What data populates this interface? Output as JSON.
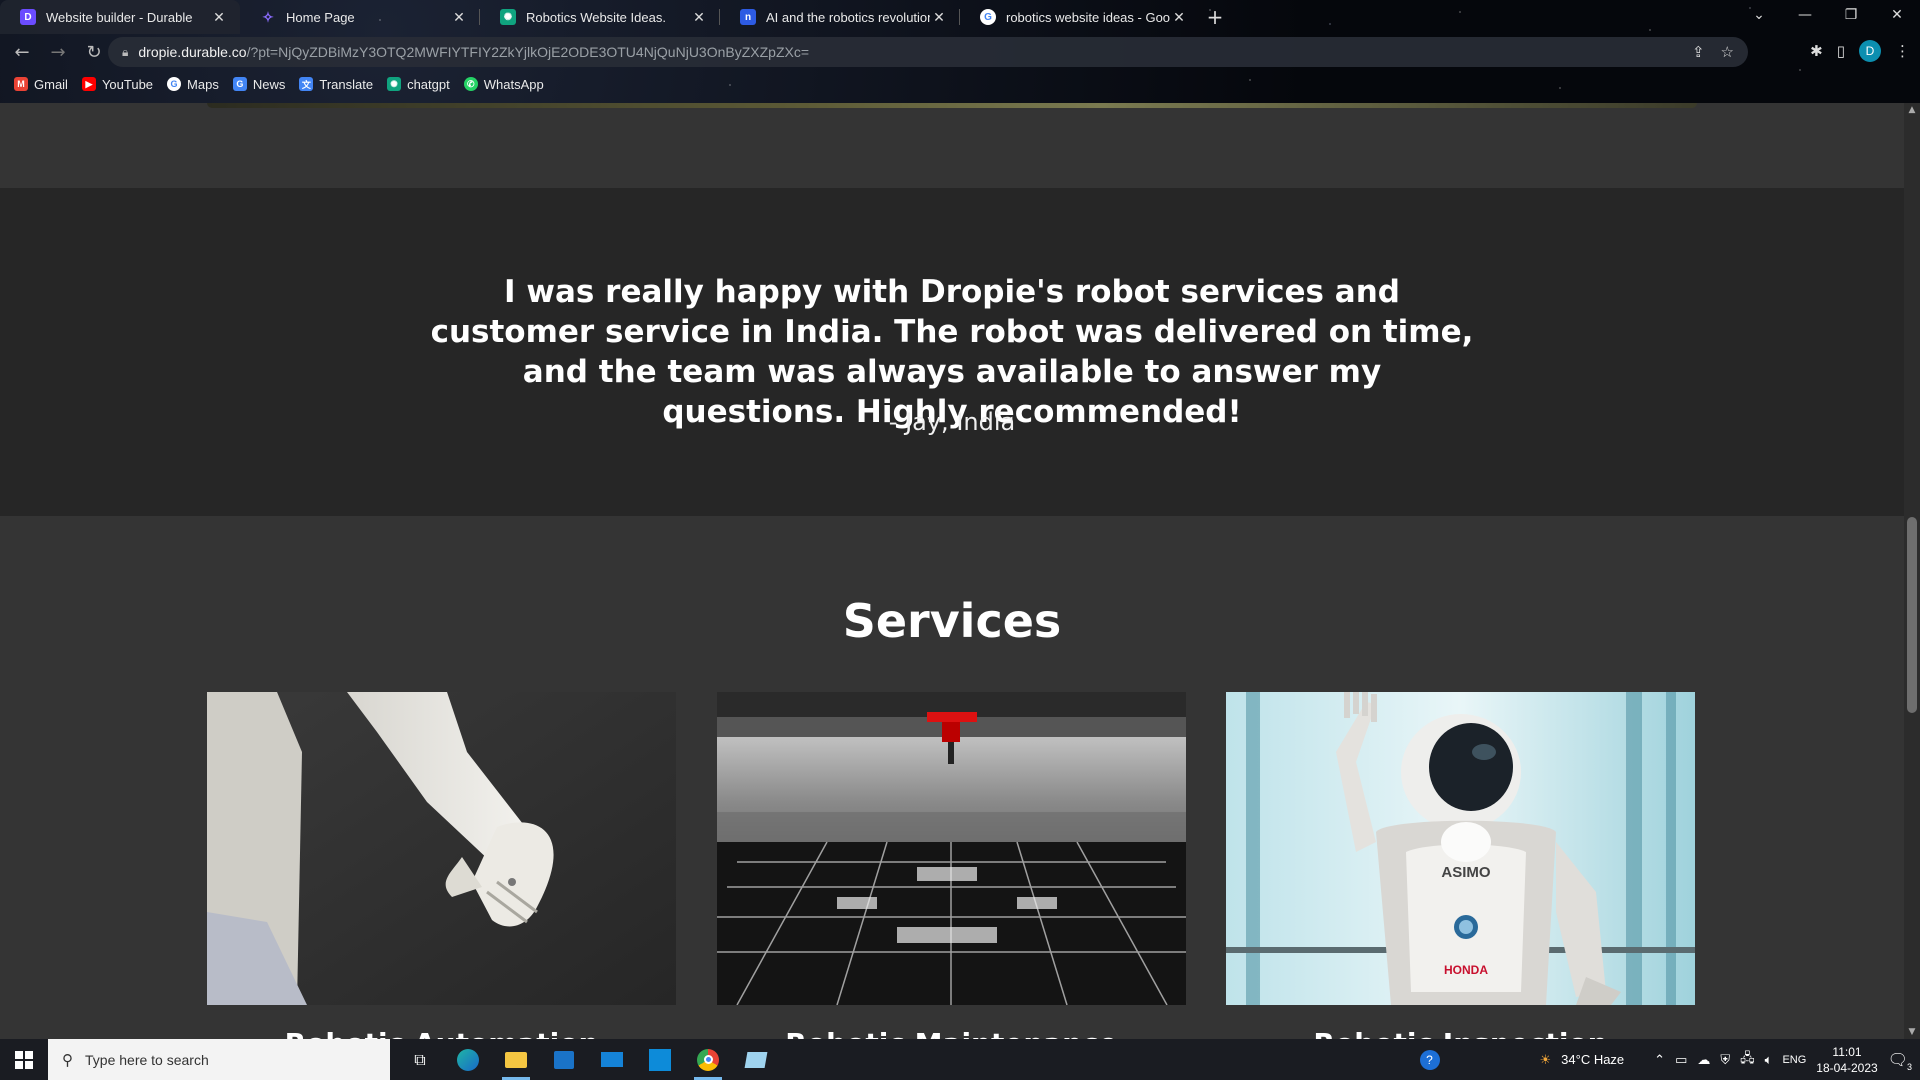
{
  "browser": {
    "tabs": [
      {
        "title": "Website builder - Durable",
        "active": true,
        "favicon_color": "#6b4cff"
      },
      {
        "title": "Home Page",
        "active": false,
        "favicon_color": "#7b5cff"
      },
      {
        "title": "Robotics Website Ideas.",
        "active": false,
        "favicon_color": "#10a37f"
      },
      {
        "title": "AI and the robotics revolution W",
        "active": false,
        "favicon_color": "#2d5be3"
      },
      {
        "title": "robotics website ideas - Google",
        "active": false,
        "favicon_color": "#4285f4"
      }
    ],
    "new_tab": "+",
    "url_host": "dropie.durable.co",
    "url_path": "/?pt=NjQyZDBiMzY3OTQ2MWFIYTFIY2ZkYjlkOjE2ODE3OTU4NjQuNjU3OnByZXZpZXc=",
    "profile_initial": "D",
    "bookmarks": [
      {
        "label": "Gmail",
        "color": "#ea4335"
      },
      {
        "label": "YouTube",
        "color": "#ff0000"
      },
      {
        "label": "Maps",
        "color": "#4285f4"
      },
      {
        "label": "News",
        "color": "#4285f4"
      },
      {
        "label": "Translate",
        "color": "#4285f4"
      },
      {
        "label": "chatgpt",
        "color": "#10a37f"
      },
      {
        "label": "WhatsApp",
        "color": "#25d366"
      }
    ]
  },
  "page": {
    "testimonial": {
      "quote": "I was really happy with Dropie's robot services and customer service in India. The robot was delivered on time, and the team was always available to answer my questions. Highly recommended!",
      "author": "- Jay, India"
    },
    "services": {
      "heading": "Services",
      "cards": [
        {
          "title": "Robotic Automation",
          "image": "white-robot-hand-photo"
        },
        {
          "title": "Robotic Maintenance",
          "image": "circuit-board-machine-photo"
        },
        {
          "title": "Robotic Inspection",
          "image": "asimo-robot-waving-photo"
        }
      ],
      "asimo_text": "ASIMO",
      "honda_text": "HONDA"
    }
  },
  "taskbar": {
    "search_placeholder": "Type here to search",
    "weather": "34°C Haze",
    "language": "ENG",
    "time": "11:01",
    "date": "18-04-2023",
    "notifications": "3"
  }
}
